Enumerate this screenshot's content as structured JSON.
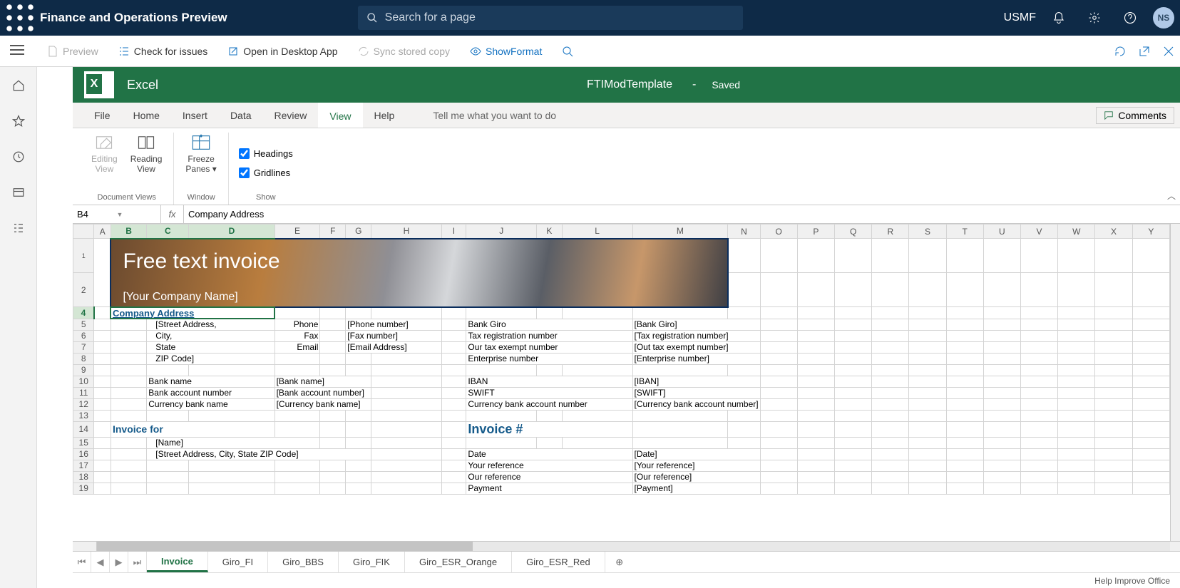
{
  "header": {
    "app_title": "Finance and Operations Preview",
    "search_placeholder": "Search for a page",
    "company": "USMF",
    "user_initials": "NS"
  },
  "actionbar": {
    "preview": "Preview",
    "check_issues": "Check for issues",
    "open_desktop": "Open in Desktop App",
    "sync_stored": "Sync stored copy",
    "show_format": "ShowFormat"
  },
  "excel": {
    "app_name": "Excel",
    "file_name": "FTIModTemplate",
    "status_sep": "-",
    "status": "Saved",
    "tabs": {
      "file": "File",
      "home": "Home",
      "insert": "Insert",
      "data": "Data",
      "review": "Review",
      "view": "View",
      "help": "Help",
      "tellme": "Tell me what you want to do",
      "comments": "Comments"
    },
    "ribbon": {
      "editing_view": "Editing\nView",
      "reading_view": "Reading\nView",
      "freeze_panes": "Freeze\nPanes",
      "headings": "Headings",
      "gridlines": "Gridlines",
      "group_docviews": "Document Views",
      "group_window": "Window",
      "group_show": "Show"
    },
    "namebox": "B4",
    "formula": "Company Address",
    "columns": [
      "A",
      "B",
      "C",
      "D",
      "E",
      "F",
      "G",
      "H",
      "I",
      "J",
      "K",
      "L",
      "M",
      "N",
      "O",
      "P",
      "Q",
      "R",
      "S",
      "T",
      "U",
      "V",
      "W",
      "X",
      "Y"
    ],
    "banner_title": "Free text invoice",
    "banner_sub": "[Your Company Name]",
    "cells": {
      "company_address": "Company Address",
      "street": "[Street Address,",
      "city": "City,",
      "state": "State",
      "zip": "ZIP Code]",
      "phone_l": "Phone",
      "phone_v": "[Phone number]",
      "fax_l": "Fax",
      "fax_v": "[Fax number]",
      "email_l": "Email",
      "email_v": "[Email Address]",
      "bankgiro_l": "Bank Giro",
      "bankgiro_v": "[Bank Giro]",
      "taxreg_l": "Tax registration number",
      "taxreg_v": "[Tax registration number]",
      "ourtax_l": "Our tax exempt number",
      "ourtax_v": "[Out tax exempt number]",
      "entnum_l": "Enterprise number",
      "entnum_v": "[Enterprise number]",
      "bankname_l": "Bank name",
      "bankname_v": "[Bank name]",
      "bankacct_l": "Bank account number",
      "bankacct_v": "[Bank account number]",
      "currbank_l": "Currency bank name",
      "currbank_v": "[Currency bank name]",
      "iban_l": "IBAN",
      "iban_v": "[IBAN]",
      "swift_l": "SWIFT",
      "swift_v": "[SWIFT]",
      "currbankacct_l": "Currency bank account number",
      "currbankacct_v": "[Currency bank account number]",
      "invoice_for": "Invoice for",
      "invoice_num": "Invoice #",
      "name_v": "[Name]",
      "addr2_v": "[Street Address, City, State ZIP Code]",
      "date_l": "Date",
      "date_v": "[Date]",
      "yourref_l": "Your reference",
      "yourref_v": "[Your reference]",
      "ourref_l": "Our reference",
      "ourref_v": "[Our reference]",
      "payment_l": "Payment",
      "payment_v": "[Payment]"
    },
    "sheets": [
      "Invoice",
      "Giro_FI",
      "Giro_BBS",
      "Giro_FIK",
      "Giro_ESR_Orange",
      "Giro_ESR_Red"
    ],
    "footer": "Help Improve Office"
  }
}
